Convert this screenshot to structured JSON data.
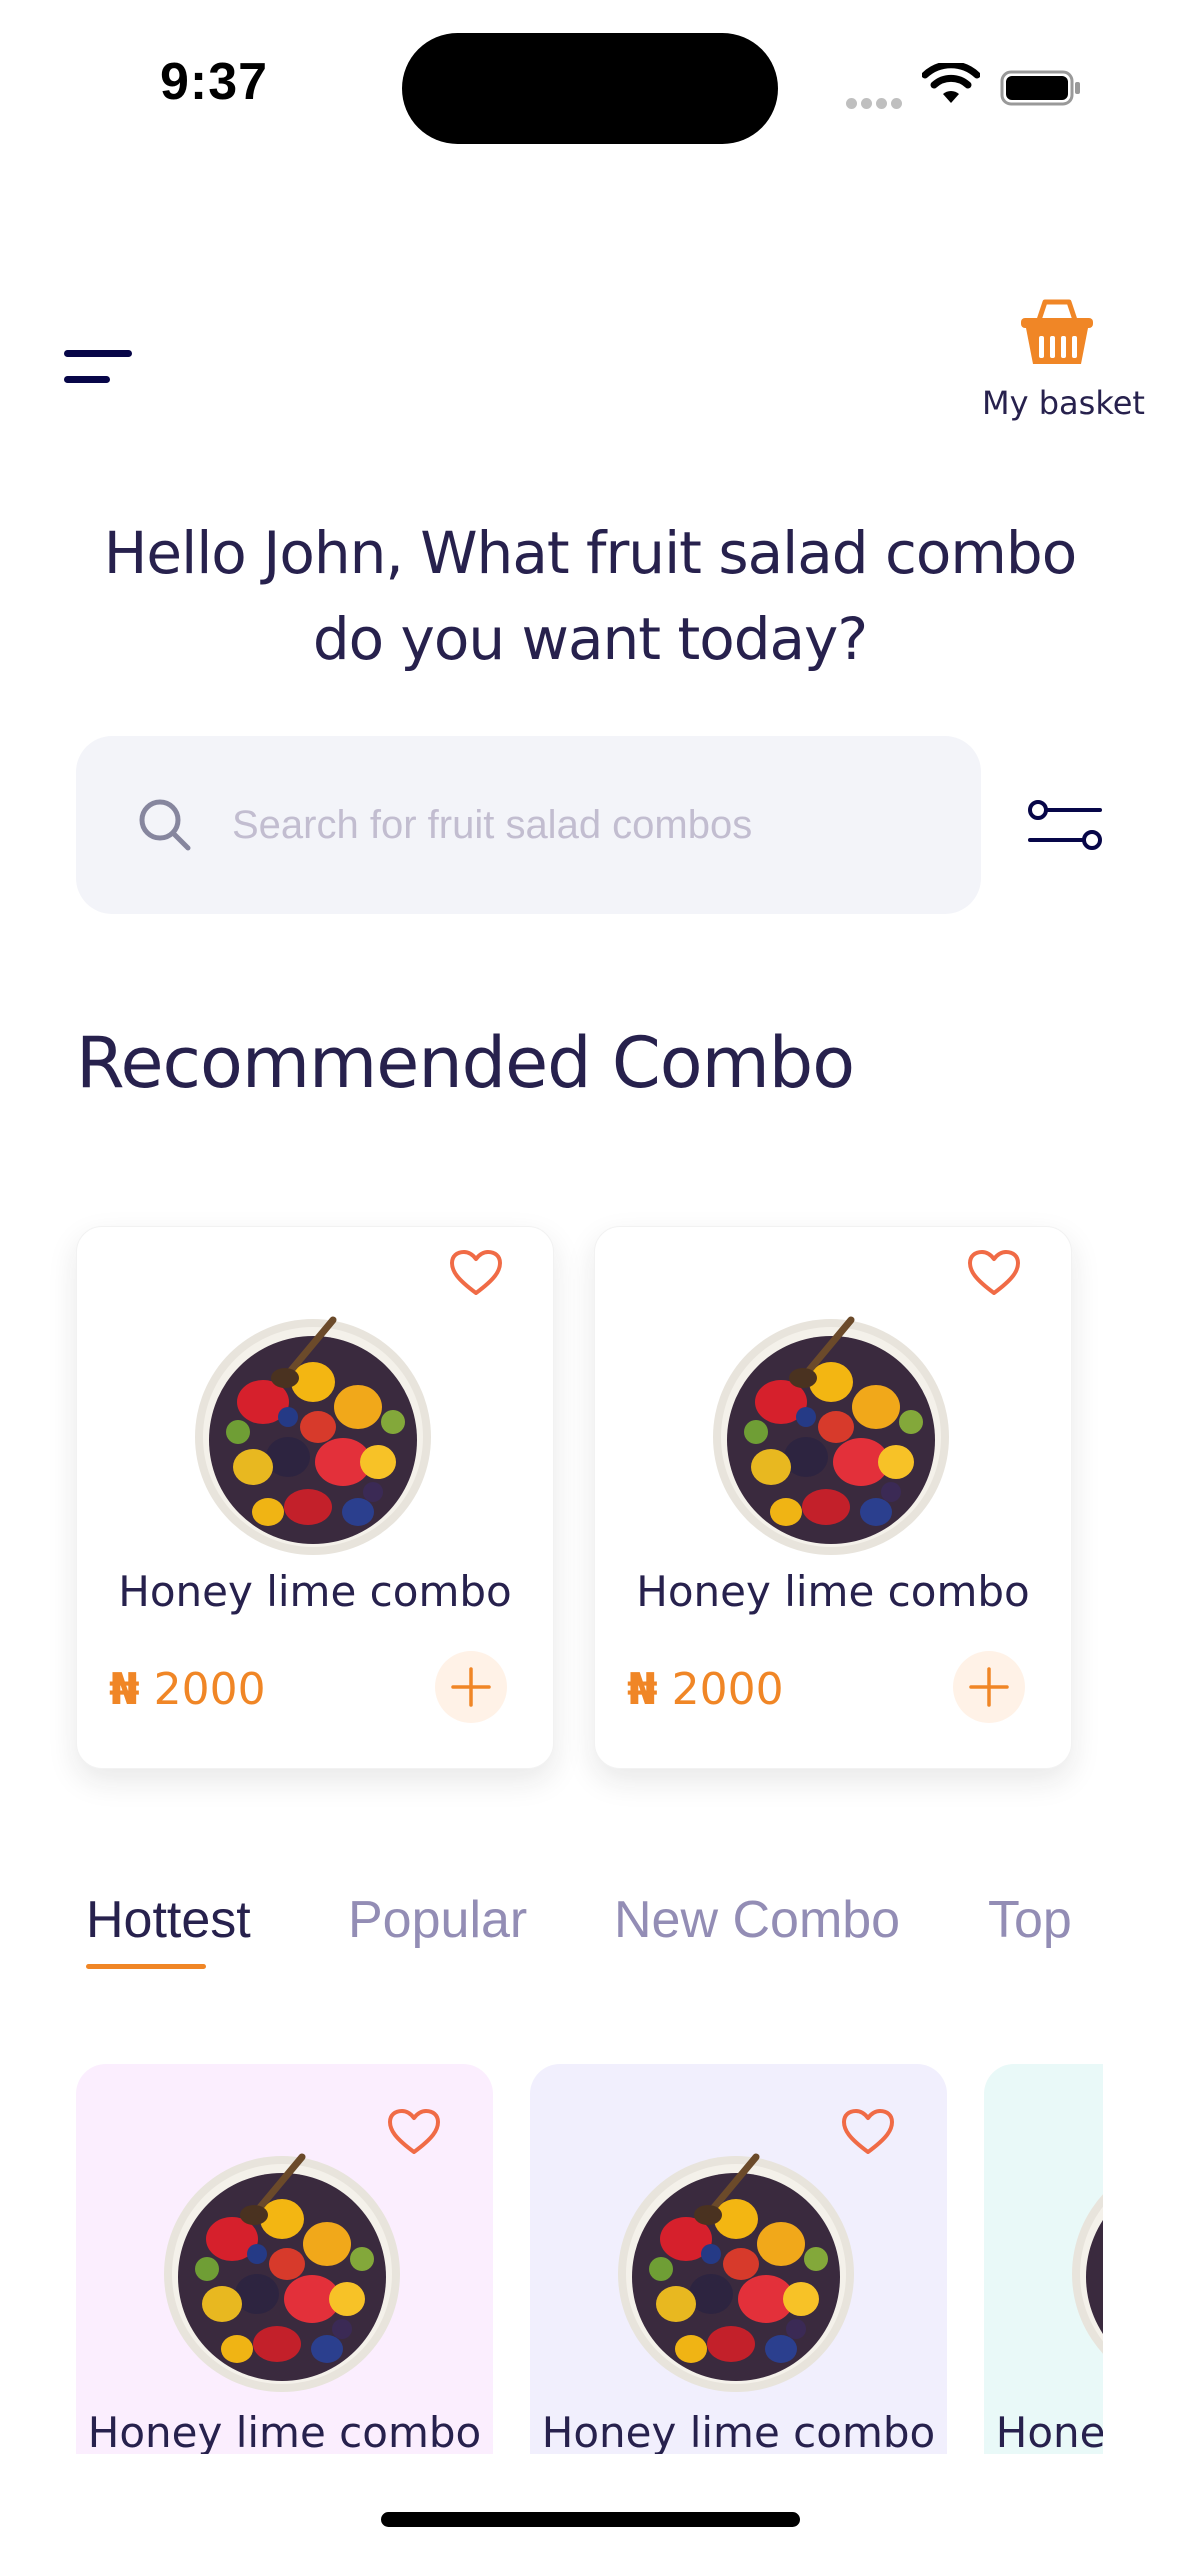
{
  "status_bar": {
    "time": "9:37"
  },
  "header": {
    "basket_label": "My basket"
  },
  "greeting": "Hello John, What fruit salad combo do you want today?",
  "search": {
    "placeholder": "Search for fruit salad combos"
  },
  "section_title": "Recommended Combo",
  "recommended": [
    {
      "name": "Honey lime combo",
      "currency": "₦",
      "price": "2000"
    },
    {
      "name": "Honey lime combo",
      "currency": "₦",
      "price": "2000"
    }
  ],
  "tabs": [
    {
      "label": "Hottest",
      "active": true
    },
    {
      "label": "Popular",
      "active": false
    },
    {
      "label": "New Combo",
      "active": false
    },
    {
      "label": "Top",
      "active": false
    }
  ],
  "hottest": [
    {
      "name": "Honey lime combo",
      "bg": "#fbeefe"
    },
    {
      "name": "Honey lime combo",
      "bg": "#f1effd"
    },
    {
      "name": "Honey lime combo",
      "bg": "#e9f9f8"
    }
  ],
  "colors": {
    "accent": "#f08626",
    "heart": "#f06b46",
    "text": "#27214d",
    "muted": "#938db5"
  },
  "icons": {
    "menu": "menu-icon",
    "basket": "basket-icon",
    "search": "search-icon",
    "filter": "filter-icon",
    "favorite": "heart-icon",
    "add": "plus-icon"
  }
}
